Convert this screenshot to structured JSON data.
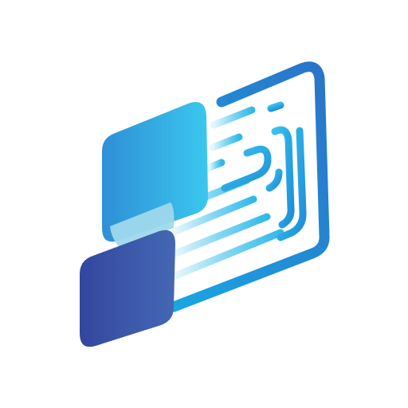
{
  "app_icon": {
    "icon_name": "fingerprint-card-logo-icon",
    "colors": {
      "background": "#ffffff",
      "light_cyan": "#3ec7ee",
      "mid_blue": "#2f9fdc",
      "frame_blue": "#1f8fd6",
      "dark_blue": "#2a4fa8",
      "deep_blue": "#37489f",
      "pale_overlap": "#9ed7eb"
    }
  }
}
